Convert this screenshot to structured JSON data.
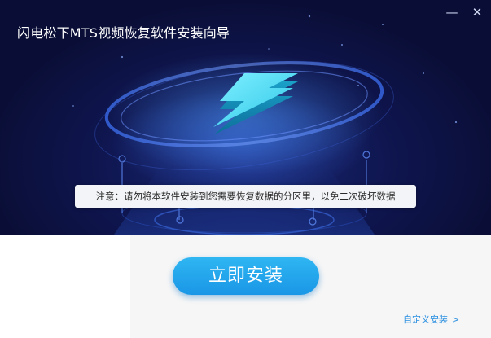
{
  "window": {
    "title": "闪电松下MTS视频恢复软件安装向导",
    "minimize_glyph": "—",
    "close_glyph": "✕"
  },
  "notice": {
    "text": "注意：请勿将本软件安装到您需要恢复数据的分区里，以免二次破坏数据"
  },
  "actions": {
    "install_label": "立即安装",
    "custom_install_label": "自定义安装",
    "custom_install_chevron": ">"
  },
  "icons": {
    "logo": "lightning-bolt-icon",
    "minimize": "minimize-icon",
    "close": "close-icon",
    "chevron": "chevron-right-icon"
  },
  "colors": {
    "banner_bg": "#0f1650",
    "bolt": "#3fd3ee",
    "install_button": "#1fa4ea",
    "link": "#2a8fe0",
    "footer_bg": "#f6f6f6"
  }
}
